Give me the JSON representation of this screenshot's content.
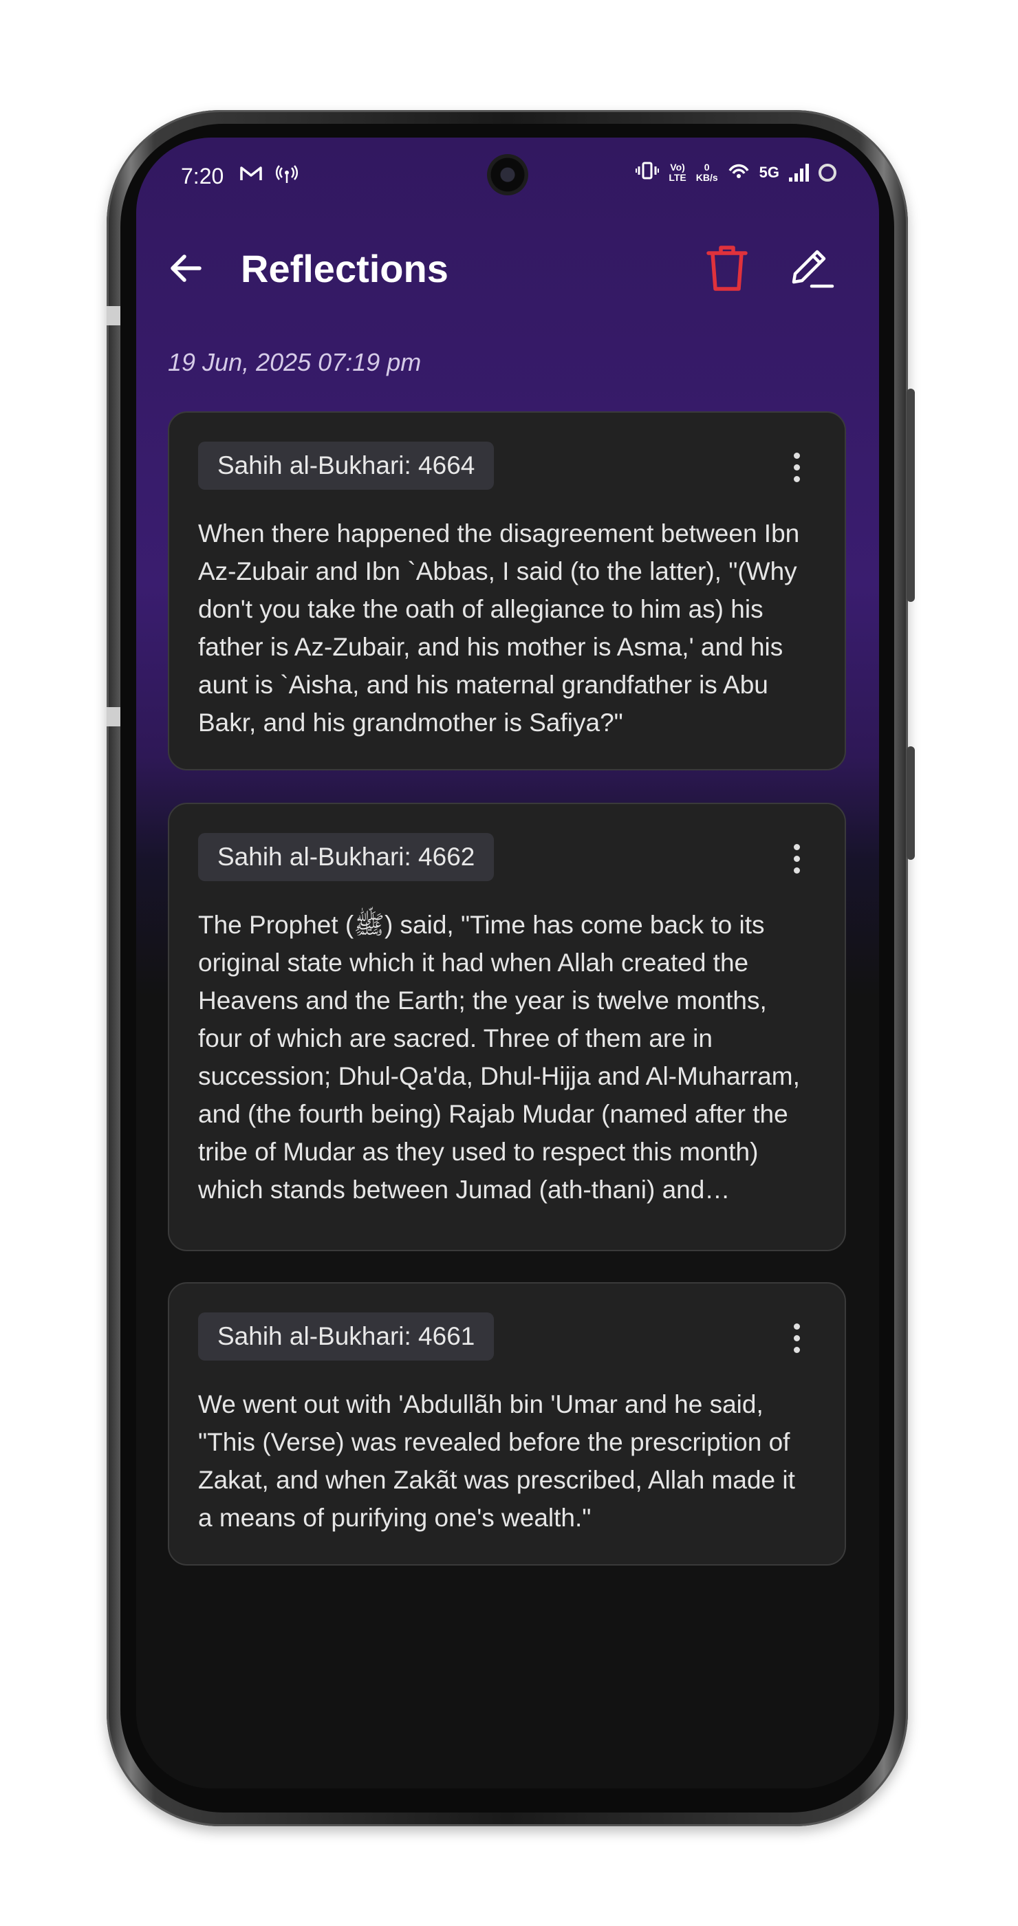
{
  "status_bar": {
    "time": "7:20",
    "left_icons": [
      "gmail-icon",
      "hotspot-icon"
    ],
    "right_icons": [
      "vibrate-icon",
      "volte-icon",
      "network-speed-icon",
      "wifi-icon",
      "5g-icon",
      "signal-icon",
      "battery-icon"
    ],
    "volte_line1": "Vo)",
    "volte_line2": "LTE",
    "speed_value": "0",
    "speed_unit": "KB/s",
    "network": "5G"
  },
  "app_bar": {
    "title": "Reflections",
    "back_icon": "arrow-left-icon",
    "delete_icon": "trash-icon",
    "edit_icon": "pencil-icon"
  },
  "date_label": "19 Jun, 2025 07:19 pm",
  "cards": [
    {
      "reference": "Sahih al-Bukhari: 4664",
      "text": "When there happened the disagreement between Ibn Az-Zubair and Ibn `Abbas, I said (to the latter), \"(Why don't you take the oath of allegiance to him as) his father is Az-Zubair, and his mother is Asma,' and his aunt is `Aisha, and his maternal grandfather is Abu Bakr, and his grandmother is Safiya?\""
    },
    {
      "reference": "Sahih al-Bukhari: 4662",
      "text": "The Prophet (ﷺ) said, \"Time has come back to its original state which it had when Allah created the Heavens and the Earth; the year is twelve months, four of which are sacred. Three of them are in succession; Dhul-Qa'da, Dhul-Hijja and Al-Muharram, and (the fourth being) Rajab Mudar (named after the tribe of Mudar as they used to respect this month) which stands between Jumad (ath-thani) and Sha'ban.\""
    },
    {
      "reference": "Sahih al-Bukhari: 4661",
      "text": "We went out with 'Abdullãh bin 'Umar and he said, \"This (Verse) was revealed before the prescription of Zakat, and when Zakãt was prescribed, Allah made it a means of purifying one's wealth.\""
    }
  ],
  "colors": {
    "accent_delete": "#e0323c",
    "header_purple": "#3a1d6f",
    "card_bg": "#222222",
    "chip_bg": "#34343a"
  }
}
